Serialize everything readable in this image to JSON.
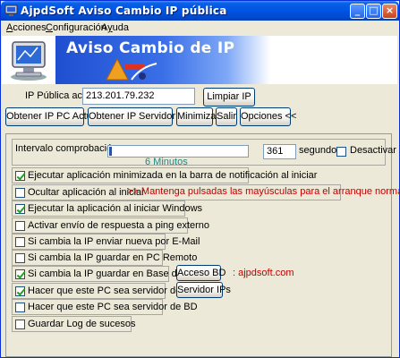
{
  "window": {
    "title": "AjpdSoft Aviso Cambio IP pública",
    "controls": {
      "minimize": "_",
      "maximize": "□",
      "close": "×"
    }
  },
  "menu": {
    "acciones": {
      "u": "A",
      "rest": "cciones"
    },
    "configuracion": {
      "u": "C",
      "rest": "onfiguración"
    },
    "ayuda": {
      "pre": "A",
      "u": "y",
      "rest": "uda"
    }
  },
  "banner": {
    "title": "Aviso Cambio de IP",
    "icon": "computer-monitor-icon",
    "logo": "ajpdsoft-logo"
  },
  "ip": {
    "label": "IP Pública actual",
    "value": "213.201.79.232",
    "clear_button": "Limpiar IP"
  },
  "toolbar": {
    "get_local_ip": "Obtener IP PC Actual",
    "get_server_ip": "Obtener IP Servidor BD",
    "minimize": "Minimizar",
    "exit": "Salir",
    "options": "Opciones <<"
  },
  "options": {
    "interval": {
      "label": "Intervalo comprobación",
      "value": "361",
      "unit": "segundos",
      "disable_label": "Desactivar",
      "disable_checked": false,
      "slider_caption": "6 Minutos",
      "slider_fraction": 0.0
    },
    "items": [
      {
        "label": "Ejecutar aplicación minimizada en la barra de notificación al iniciar",
        "checked": true
      },
      {
        "label": "Ocultar aplicación al iniciar",
        "checked": false,
        "note": ">> Mantenga pulsadas las mayúsculas para el arranque normal"
      },
      {
        "label": "Ejecutar la aplicación al iniciar Windows",
        "checked": true
      },
      {
        "label": "Activar envío de respuesta a ping externo",
        "checked": false
      },
      {
        "label": "Si cambia la IP enviar nueva por E-Mail",
        "checked": false
      },
      {
        "label": "Si cambia la IP guardar en PC Remoto",
        "checked": false
      },
      {
        "label": "Si cambia la IP guardar en Base de datos",
        "checked": true,
        "button": "Acceso BD",
        "note": ": ajpdsoft.com"
      },
      {
        "label": "Hacer que este PC sea servidor de IPs",
        "checked": true,
        "button": "Servidor IPs"
      },
      {
        "label": "Hacer que este PC sea servidor de BD",
        "checked": false
      },
      {
        "label": "Guardar Log de sucesos",
        "checked": false
      }
    ]
  },
  "colors": {
    "titlebar": "#0054e3",
    "window_bg": "#ece9d8",
    "note_red": "#c00000",
    "caption_teal": "#1a8a8a"
  }
}
